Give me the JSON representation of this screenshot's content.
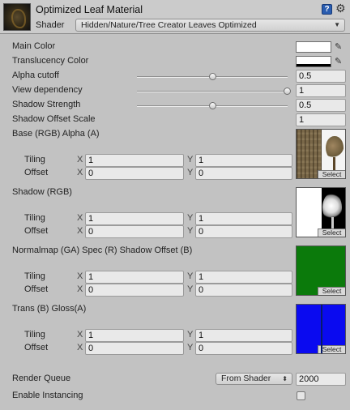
{
  "header": {
    "title": "Optimized Leaf Material",
    "shader_label": "Shader",
    "shader_value": "Hidden/Nature/Tree Creator Leaves Optimized",
    "help_icon": "help-icon",
    "gear_icon": "gear-icon"
  },
  "properties": {
    "main_color": {
      "label": "Main Color",
      "color": "#ffffff"
    },
    "translucency_color": {
      "label": "Translucency Color",
      "color": "#ffffff"
    },
    "alpha_cutoff": {
      "label": "Alpha cutoff",
      "value": "0.5",
      "fraction": 0.5
    },
    "view_dependency": {
      "label": "View dependency",
      "value": "1",
      "fraction": 1.0
    },
    "shadow_strength": {
      "label": "Shadow Strength",
      "value": "0.5",
      "fraction": 0.5
    },
    "shadow_offset_scale": {
      "label": "Shadow Offset Scale",
      "value": "1"
    }
  },
  "axis": {
    "x": "X",
    "y": "Y"
  },
  "sub_labels": {
    "tiling": "Tiling",
    "offset": "Offset"
  },
  "textures": [
    {
      "label": "Base (RGB) Alpha (A)",
      "tiling_x": "1",
      "tiling_y": "1",
      "offset_x": "0",
      "offset_y": "0",
      "select": "Select"
    },
    {
      "label": "Shadow (RGB)",
      "tiling_x": "1",
      "tiling_y": "1",
      "offset_x": "0",
      "offset_y": "0",
      "select": "Select"
    },
    {
      "label": "Normalmap (GA) Spec (R) Shadow Offset (B)",
      "tiling_x": "1",
      "tiling_y": "1",
      "offset_x": "0",
      "offset_y": "0",
      "select": "Select"
    },
    {
      "label": "Trans (B) Gloss(A)",
      "tiling_x": "1",
      "tiling_y": "1",
      "offset_x": "0",
      "offset_y": "0",
      "select": "Select"
    }
  ],
  "footer": {
    "render_queue_label": "Render Queue",
    "render_queue_mode": "From Shader",
    "render_queue_value": "2000",
    "enable_instancing_label": "Enable Instancing"
  },
  "colors": {
    "background": "#c2c2c2",
    "normalmap_texture": "#0b7a0b",
    "trans_texture": "#0a0af0"
  }
}
